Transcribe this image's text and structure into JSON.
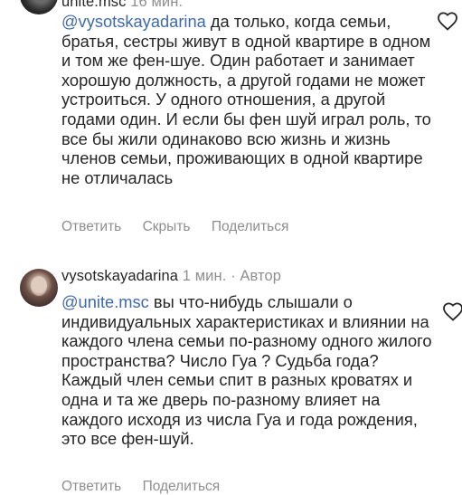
{
  "comments": [
    {
      "username": "unite.msc",
      "time": "16 мин.",
      "mention": "@vysotskayadarina",
      "text": " да только, когда семьи, братья, сестры живут в одной квартире в одном и том же фен-шуе. Один работает и занимает хорошую должность, а другой годами не может устроиться. У одного отношения, а другой годами один. И если бы фен шуй играл роль, то все бы жили одинаково всю жизнь и жизнь членов семьи, проживающих в одной квартире не отличалась",
      "actions": [
        "Ответить",
        "Скрыть",
        "Поделиться"
      ]
    },
    {
      "username": "vysotskayadarina",
      "time": "1 мин. · Автор",
      "mention": "@unite.msc",
      "text": " вы что-нибудь слышали о индивидуальных характеристиках и влиянии на каждого члена семьи по-разному одного жилого пространства? Число Гуа ? Судьба года? Каждый член семьи спит в разных кроватях и одна и та же дверь по-разному влияет на каждого исходя из числа Гуа и года рождения, это все фен-шуй.",
      "actions": [
        "Ответить",
        "Поделиться"
      ]
    }
  ],
  "icons": {
    "like": "heart-outline-icon"
  },
  "colors": {
    "mention": "#3f6aa8",
    "muted": "#8e8e8e",
    "text": "#262626"
  }
}
